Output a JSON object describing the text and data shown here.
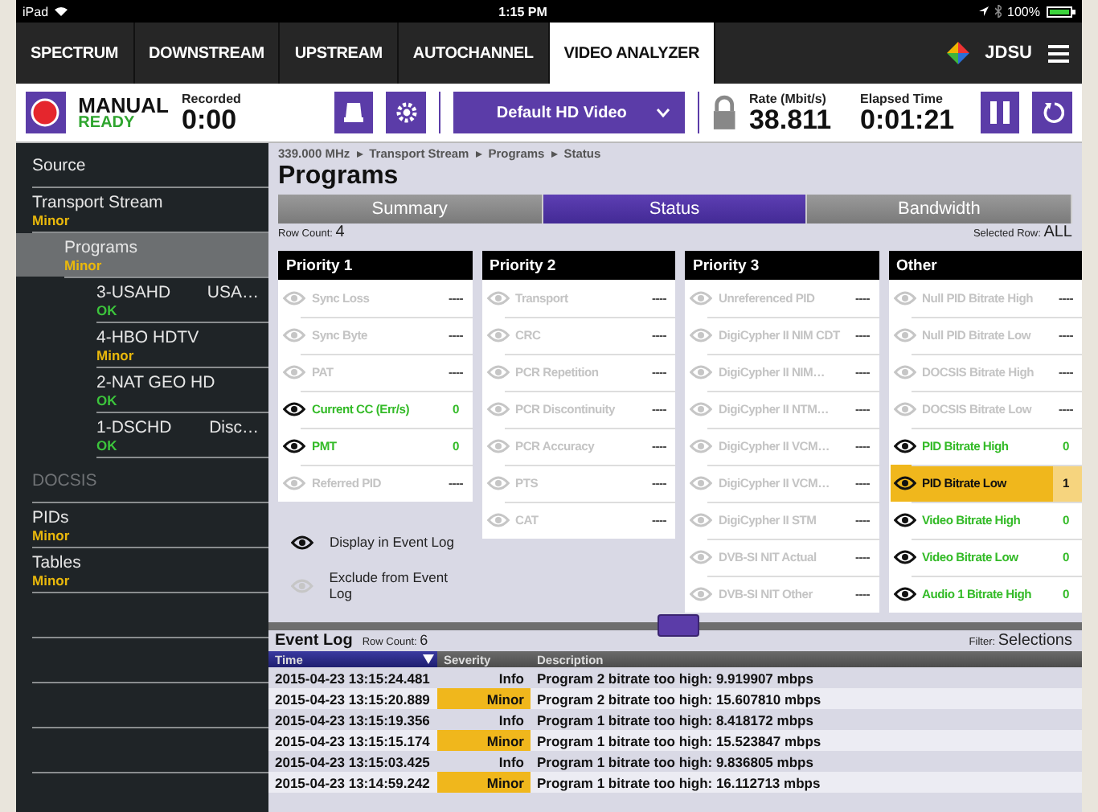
{
  "status_bar": {
    "device": "iPad",
    "time": "1:15 PM",
    "battery": "100%"
  },
  "tabs": [
    {
      "label": "SPECTRUM",
      "selected": false
    },
    {
      "label": "DOWNSTREAM",
      "selected": false
    },
    {
      "label": "UPSTREAM",
      "selected": false
    },
    {
      "label": "AUTOCHANNEL",
      "selected": false
    },
    {
      "label": "VIDEO ANALYZER",
      "selected": true
    }
  ],
  "brand": "JDSU",
  "toolbar": {
    "mode": "MANUAL",
    "state": "READY",
    "recorded_label": "Recorded",
    "recorded": "0:00",
    "profile": "Default HD Video",
    "rate_label": "Rate (Mbit/s)",
    "rate": "38.811",
    "elapsed_label": "Elapsed Time",
    "elapsed": "0:01:21"
  },
  "sidebar": {
    "items": [
      {
        "label": "Source",
        "selected": false,
        "disabled": false
      },
      {
        "label": "Transport Stream",
        "status": "Minor",
        "color": "#e9b80c",
        "selected": false,
        "disabled": false,
        "children": [
          {
            "label": "Programs",
            "status": "Minor",
            "color": "#e9b80c",
            "selected": true,
            "disabled": false,
            "children": [
              {
                "label": "3-USAHD",
                "detail": "USA…",
                "status": "OK",
                "color": "#3cc43c",
                "selected": false,
                "disabled": false
              },
              {
                "label": "4-HBO HDTV",
                "status": "Minor",
                "color": "#e9b80c",
                "selected": false,
                "disabled": false
              },
              {
                "label": "2-NAT GEO HD",
                "status": "OK",
                "color": "#3cc43c",
                "selected": false,
                "disabled": false
              },
              {
                "label": "1-DSCHD",
                "detail": "Disc…",
                "status": "OK",
                "color": "#3cc43c",
                "selected": false,
                "disabled": false
              }
            ]
          }
        ]
      },
      {
        "label": "DOCSIS",
        "selected": false,
        "disabled": true
      },
      {
        "label": "PIDs",
        "status": "Minor",
        "color": "#e9b80c",
        "selected": false,
        "disabled": false
      },
      {
        "label": "Tables",
        "status": "Minor",
        "color": "#e9b80c",
        "selected": false,
        "disabled": false
      }
    ]
  },
  "breadcrumb": [
    "339.000 MHz",
    "Transport Stream",
    "Programs",
    "Status"
  ],
  "title": "Programs",
  "view_tabs": [
    {
      "label": "Summary",
      "selected": false
    },
    {
      "label": "Status",
      "selected": true
    },
    {
      "label": "Bandwidth",
      "selected": false
    }
  ],
  "row_count_label": "Row Count:",
  "row_count": "4",
  "selected_row_label": "Selected Row:",
  "selected_row": "ALL",
  "tables": [
    {
      "title": "Priority 1",
      "rows": [
        {
          "label": "Sync Loss",
          "value": "----",
          "enabled": false,
          "alarm": false
        },
        {
          "label": "Sync Byte",
          "value": "----",
          "enabled": false,
          "alarm": false
        },
        {
          "label": "PAT",
          "value": "----",
          "enabled": false,
          "alarm": false
        },
        {
          "label": "Current CC (Err/s)",
          "value": "0",
          "enabled": true,
          "alarm": false
        },
        {
          "label": "PMT",
          "value": "0",
          "enabled": true,
          "alarm": false
        },
        {
          "label": "Referred PID",
          "value": "----",
          "enabled": false,
          "alarm": false
        }
      ]
    },
    {
      "title": "Priority 2",
      "rows": [
        {
          "label": "Transport",
          "value": "----",
          "enabled": false,
          "alarm": false
        },
        {
          "label": "CRC",
          "value": "----",
          "enabled": false,
          "alarm": false
        },
        {
          "label": "PCR Repetition",
          "value": "----",
          "enabled": false,
          "alarm": false
        },
        {
          "label": "PCR Discontinuity",
          "value": "----",
          "enabled": false,
          "alarm": false
        },
        {
          "label": "PCR Accuracy",
          "value": "----",
          "enabled": false,
          "alarm": false
        },
        {
          "label": "PTS",
          "value": "----",
          "enabled": false,
          "alarm": false
        },
        {
          "label": "CAT",
          "value": "----",
          "enabled": false,
          "alarm": false
        }
      ]
    },
    {
      "title": "Priority 3",
      "rows": [
        {
          "label": "Unreferenced PID",
          "value": "----",
          "enabled": false,
          "alarm": false
        },
        {
          "label": "DigiCypher II NIM CDT",
          "value": "----",
          "enabled": false,
          "alarm": false
        },
        {
          "label": "DigiCypher II NIM…",
          "value": "----",
          "enabled": false,
          "alarm": false
        },
        {
          "label": "DigiCypher II NTM…",
          "value": "----",
          "enabled": false,
          "alarm": false
        },
        {
          "label": "DigiCypher II VCM…",
          "value": "----",
          "enabled": false,
          "alarm": false
        },
        {
          "label": "DigiCypher II VCM…",
          "value": "----",
          "enabled": false,
          "alarm": false
        },
        {
          "label": "DigiCypher II STM",
          "value": "----",
          "enabled": false,
          "alarm": false
        },
        {
          "label": "DVB-SI NIT Actual",
          "value": "----",
          "enabled": false,
          "alarm": false
        },
        {
          "label": "DVB-SI NIT Other",
          "value": "----",
          "enabled": false,
          "alarm": false
        }
      ]
    },
    {
      "title": "Other",
      "rows": [
        {
          "label": "Null PID Bitrate High",
          "value": "----",
          "enabled": false,
          "alarm": false
        },
        {
          "label": "Null PID Bitrate Low",
          "value": "----",
          "enabled": false,
          "alarm": false
        },
        {
          "label": "DOCSIS Bitrate High",
          "value": "----",
          "enabled": false,
          "alarm": false
        },
        {
          "label": "DOCSIS Bitrate Low",
          "value": "----",
          "enabled": false,
          "alarm": false
        },
        {
          "label": "PID Bitrate High",
          "value": "0",
          "enabled": true,
          "alarm": false
        },
        {
          "label": "PID Bitrate Low",
          "value": "1",
          "enabled": true,
          "alarm": true
        },
        {
          "label": "Video Bitrate High",
          "value": "0",
          "enabled": true,
          "alarm": false
        },
        {
          "label": "Video Bitrate Low",
          "value": "0",
          "enabled": true,
          "alarm": false
        },
        {
          "label": "Audio 1 Bitrate High",
          "value": "0",
          "enabled": true,
          "alarm": false
        }
      ]
    }
  ],
  "legend": [
    {
      "label": "Display in Event Log",
      "enabled": true
    },
    {
      "label": "Exclude from Event Log",
      "enabled": false
    }
  ],
  "event_log": {
    "title": "Event Log",
    "row_count_label": "Row Count:",
    "row_count": "6",
    "filter_label": "Filter:",
    "filter": "Selections",
    "columns": [
      {
        "label": "Time",
        "sorted": true
      },
      {
        "label": "Severity",
        "sorted": false
      },
      {
        "label": "Description",
        "sorted": false
      }
    ],
    "rows": [
      {
        "time": "2015-04-23 13:15:24.481",
        "severity": "Info",
        "highlighted": false,
        "description": "Program 2 bitrate too high: 9.919907 mbps"
      },
      {
        "time": "2015-04-23 13:15:20.889",
        "severity": "Minor",
        "highlighted": true,
        "description": "Program 2 bitrate too high: 15.607810 mbps"
      },
      {
        "time": "2015-04-23 13:15:19.356",
        "severity": "Info",
        "highlighted": false,
        "description": "Program 1 bitrate too high: 8.418172 mbps"
      },
      {
        "time": "2015-04-23 13:15:15.174",
        "severity": "Minor",
        "highlighted": true,
        "description": "Program 1 bitrate too high: 15.523847 mbps"
      },
      {
        "time": "2015-04-23 13:15:03.425",
        "severity": "Info",
        "highlighted": false,
        "description": "Program 1 bitrate too high: 9.836805 mbps"
      },
      {
        "time": "2015-04-23 13:14:59.242",
        "severity": "Minor",
        "highlighted": true,
        "description": "Program 1 bitrate too high: 16.112713 mbps"
      }
    ]
  }
}
